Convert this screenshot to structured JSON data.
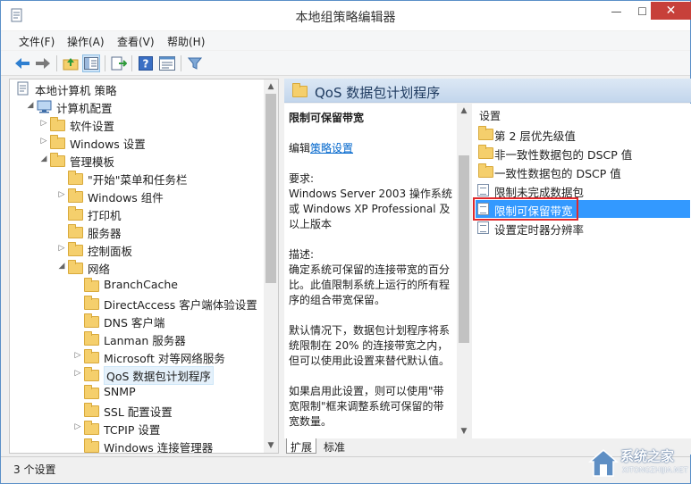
{
  "window": {
    "title": "本地组策略编辑器",
    "controls": {
      "minimize": "—",
      "maximize": "☐",
      "close": "✕"
    }
  },
  "menubar": {
    "items": [
      "文件(F)",
      "操作(A)",
      "查看(V)",
      "帮助(H)"
    ]
  },
  "toolbar": {
    "icons": [
      "back-arrow-icon",
      "forward-arrow-icon",
      "up-folder-icon",
      "show-hide-tree-icon",
      "export-list-icon",
      "help-icon",
      "properties-icon",
      "filter-icon"
    ]
  },
  "tree": {
    "items": [
      {
        "label": "本地计算机 策略",
        "expand": "",
        "icon": "policy-icon",
        "selected": false
      },
      {
        "label": "计算机配置",
        "expand": "◢",
        "icon": "computer-icon",
        "selected": false
      },
      {
        "label": "软件设置",
        "expand": "▷",
        "icon": "folder-icon",
        "selected": false
      },
      {
        "label": "Windows 设置",
        "expand": "▷",
        "icon": "folder-icon",
        "selected": false
      },
      {
        "label": "管理模板",
        "expand": "◢",
        "icon": "folder-icon",
        "selected": false
      },
      {
        "label": "\"开始\"菜单和任务栏",
        "expand": "",
        "icon": "folder-icon",
        "selected": false
      },
      {
        "label": "Windows 组件",
        "expand": "▷",
        "icon": "folder-icon",
        "selected": false
      },
      {
        "label": "打印机",
        "expand": "",
        "icon": "folder-icon",
        "selected": false
      },
      {
        "label": "服务器",
        "expand": "",
        "icon": "folder-icon",
        "selected": false
      },
      {
        "label": "控制面板",
        "expand": "▷",
        "icon": "folder-icon",
        "selected": false
      },
      {
        "label": "网络",
        "expand": "◢",
        "icon": "folder-icon",
        "selected": false
      },
      {
        "label": "BranchCache",
        "expand": "",
        "icon": "folder-icon",
        "selected": false
      },
      {
        "label": "DirectAccess 客户端体验设置",
        "expand": "",
        "icon": "folder-icon",
        "selected": false
      },
      {
        "label": "DNS 客户端",
        "expand": "",
        "icon": "folder-icon",
        "selected": false
      },
      {
        "label": "Lanman 服务器",
        "expand": "",
        "icon": "folder-icon",
        "selected": false
      },
      {
        "label": "Microsoft 对等网络服务",
        "expand": "▷",
        "icon": "folder-icon",
        "selected": false
      },
      {
        "label": "QoS 数据包计划程序",
        "expand": "▷",
        "icon": "folder-icon",
        "selected": true
      },
      {
        "label": "SNMP",
        "expand": "",
        "icon": "folder-icon",
        "selected": false
      },
      {
        "label": "SSL 配置设置",
        "expand": "",
        "icon": "folder-icon",
        "selected": false
      },
      {
        "label": "TCPIP 设置",
        "expand": "▷",
        "icon": "folder-icon",
        "selected": false
      },
      {
        "label": "Windows 连接管理器",
        "expand": "",
        "icon": "folder-icon",
        "selected": false
      }
    ]
  },
  "right": {
    "header_title": "QoS 数据包计划程序",
    "description": {
      "setting_name": "限制可保留带宽",
      "edit_prefix": "编辑",
      "edit_link": "策略设置",
      "requirements_label": "要求:",
      "requirements_text": "Windows Server 2003 操作系统或 Windows XP Professional 及以上版本",
      "description_label": "描述:",
      "description_text": "确定系统可保留的连接带宽的百分比。此值限制系统上运行的所有程序的组合带宽保留。",
      "default_text": "默认情况下，数据包计划程序将系统限制在 20% 的连接带宽之内，但可以使用此设置来替代默认值。",
      "enabled_text": "如果启用此设置，则可以使用\"带宽限制\"框来调整系统可保留的带宽数量。"
    },
    "list_header": "设置",
    "settings": [
      {
        "label": "第 2 层优先级值",
        "type": "folder"
      },
      {
        "label": "非一致性数据包的 DSCP 值",
        "type": "folder"
      },
      {
        "label": "一致性数据包的 DSCP 值",
        "type": "folder"
      },
      {
        "label": "限制未完成数据包",
        "type": "setting"
      },
      {
        "label": "限制可保留带宽",
        "type": "setting",
        "selected": true
      },
      {
        "label": "设置定时器分辨率",
        "type": "setting"
      }
    ],
    "tabs": [
      "扩展",
      "标准"
    ]
  },
  "statusbar": {
    "text": "3 个设置"
  },
  "watermark": {
    "text": "系统之家",
    "url": "XITONGZHIJIA.NET"
  }
}
